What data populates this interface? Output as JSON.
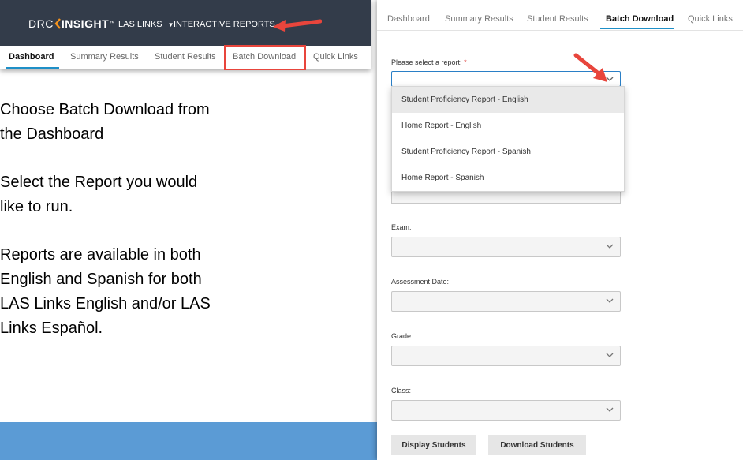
{
  "header": {
    "logo_left": "DRC",
    "logo_right": "INSIGHT",
    "logo_tm": "™",
    "app_menu": "LAS LINKS",
    "reports_menu": "INTERACTIVE REPORTS"
  },
  "left_tabs": [
    "Dashboard",
    "Summary Results",
    "Student Results",
    "Batch Download",
    "Quick Links"
  ],
  "instructions": [
    "Choose Batch Download from the Dashboard",
    "Select the Report you would like to run.",
    "Reports are available in both English and Spanish for both LAS Links English and/or LAS Links Español."
  ],
  "instruction_lines": [
    [
      "Choose Batch Download from",
      "the Dashboard"
    ],
    [
      "Select the Report you would",
      "like to run."
    ],
    [
      "Reports are available in both",
      "English and Spanish for both",
      "LAS Links English and/or LAS",
      "Links Español."
    ]
  ],
  "right_tabs": [
    "Dashboard",
    "Summary Results",
    "Student Results",
    "Batch Download",
    "Quick Links"
  ],
  "form": {
    "report_label": "Please select a report:",
    "required_mark": "*",
    "report_options": [
      "Student Proficiency Report - English",
      "Home Report - English",
      "Student Proficiency Report - Spanish",
      "Home Report - Spanish"
    ],
    "exam_label": "Exam:",
    "assessment_date_label": "Assessment Date:",
    "grade_label": "Grade:",
    "class_label": "Class:",
    "display_button": "Display Students",
    "download_button": "Download Students"
  },
  "colors": {
    "header_bg": "#333c4a",
    "accent_blue": "#1e8fc7",
    "callout_red": "#e8453c",
    "band_blue": "#5b9bd5"
  }
}
